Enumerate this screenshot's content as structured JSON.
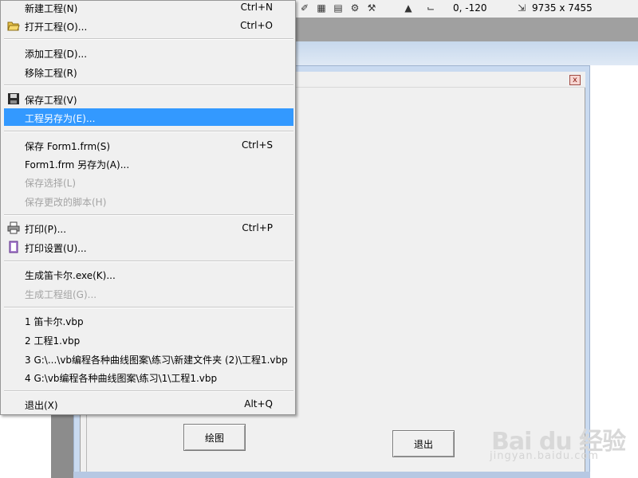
{
  "toolbar": {
    "position_label": "0, -120",
    "size_label": "9735 x 7455"
  },
  "form": {
    "draw_button": "绘图",
    "exit_button": "退出",
    "close_glyph": "x"
  },
  "menu": {
    "items": [
      {
        "label": "新建工程(N)",
        "shortcut": "Ctrl+N",
        "icon": "none"
      },
      {
        "label": "打开工程(O)...",
        "shortcut": "Ctrl+O",
        "icon": "open-folder-icon"
      },
      {
        "label": "添加工程(D)...",
        "shortcut": ""
      },
      {
        "label": "移除工程(R)",
        "shortcut": ""
      },
      {
        "label": "保存工程(V)",
        "shortcut": "",
        "icon": "floppy-disk-icon"
      },
      {
        "label": "工程另存为(E)...",
        "shortcut": "",
        "selected": true
      },
      {
        "label": "保存 Form1.frm(S)",
        "shortcut": "Ctrl+S"
      },
      {
        "label": "Form1.frm 另存为(A)...",
        "shortcut": ""
      },
      {
        "label": "保存选择(L)",
        "shortcut": "",
        "disabled": true
      },
      {
        "label": "保存更改的脚本(H)",
        "shortcut": "",
        "disabled": true
      },
      {
        "label": "打印(P)...",
        "shortcut": "Ctrl+P",
        "icon": "printer-icon"
      },
      {
        "label": "打印设置(U)...",
        "shortcut": "",
        "icon": "print-setup-icon"
      },
      {
        "label": "生成笛卡尔.exe(K)...",
        "shortcut": ""
      },
      {
        "label": "生成工程组(G)...",
        "shortcut": "",
        "disabled": true
      },
      {
        "label": "1 笛卡尔.vbp",
        "shortcut": ""
      },
      {
        "label": "2 工程1.vbp",
        "shortcut": ""
      },
      {
        "label": "3 G:\\...\\vb编程各种曲线图案\\练习\\新建文件夹 (2)\\工程1.vbp",
        "shortcut": ""
      },
      {
        "label": "4 G:\\vb编程各种曲线图案\\练习\\1\\工程1.vbp",
        "shortcut": ""
      },
      {
        "label": "退出(X)",
        "shortcut": "Alt+Q"
      }
    ]
  },
  "watermark": {
    "brand": "Bai du 经验",
    "site": "jingyan.baidu.com"
  },
  "colors": {
    "menu_highlight": "#3399ff",
    "disabled_text": "#a3a3a3",
    "form_border": "#c9daf0"
  }
}
